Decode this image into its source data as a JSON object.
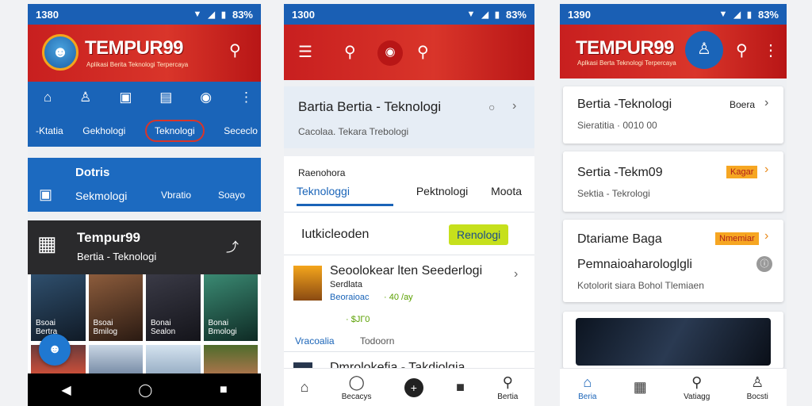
{
  "phone1": {
    "status": {
      "time": "1380",
      "battery": "83%"
    },
    "header": {
      "brand": "TEMPUR99",
      "tagline": "Aplikasi Berita Teknologi Terpercaya"
    },
    "nav_tabs": [
      "-Ktatia",
      "Gekhologi",
      "Teknologi",
      "Sececlo"
    ],
    "nav_active_index": 2,
    "blue_card": {
      "title": "Dotris",
      "subtitle": "Sekmologi",
      "col2": "Vbratio",
      "col3": "Soayo"
    },
    "dark_card": {
      "title": "Tempur99",
      "subtitle": "Bertia - Teknologi"
    },
    "thumbs": [
      {
        "line1": "Bsoai",
        "line2": "Bertra"
      },
      {
        "line1": "Bsoai",
        "line2": "Bmilog"
      },
      {
        "line1": "Bonai",
        "line2": "Sealon"
      },
      {
        "line1": "Bonai",
        "line2": "Bmologi"
      }
    ]
  },
  "phone2": {
    "status": {
      "time": "1300",
      "battery": "83%"
    },
    "search_card": {
      "title": "Bartia Bertia - Teknologi",
      "subtitle": "Cacolaa. Tekara Trebologi"
    },
    "section_label": "Raenohora",
    "tabs": [
      "Teknologgi",
      "Pektnologi",
      "Moota"
    ],
    "tab_active_index": 0,
    "row_title": "Iutkicleoden",
    "row_chip": "Renologi",
    "article1": {
      "title": "Seoolokear lten Seederlogi",
      "sub1": "Serdlata",
      "sub2": "Beoraioac",
      "meta1": "· 40 /ay",
      "meta2": "· $ЈГ0",
      "source": "Vracoalia",
      "source2": "Todoorn"
    },
    "article2": {
      "title": "Dmrolokefia - Takdiolgia"
    },
    "bottom_nav": [
      "",
      "Becacys",
      "",
      "",
      "Bertia"
    ]
  },
  "phone3": {
    "status": {
      "time": "1390",
      "battery": "83%"
    },
    "header": {
      "brand": "TEMPUR99",
      "tagline": "Aplkasi Berta Teknologi Terpercaya"
    },
    "card1": {
      "title": "Bertia -Teknologi",
      "action": "Boera",
      "subtitle": "Sieratitia · 0010 00"
    },
    "card2": {
      "title": "Sertia -Tekm09",
      "tag": "Kagar",
      "subtitle": "Sektia - Tekrologi"
    },
    "card3": {
      "title": "Dtariame Baga",
      "tag": "Nmemiar",
      "line2": "Pemnaioaharologlgli",
      "line3": "Kotolorit siara Bohol Tlemiaen"
    },
    "bottom_nav": [
      "Beria",
      "",
      "Vatiagg",
      "Bocsti"
    ]
  },
  "colors": {
    "red": "#d9352a",
    "blue": "#1a64b8",
    "orange": "#f6a622",
    "green": "#c6e01c"
  }
}
